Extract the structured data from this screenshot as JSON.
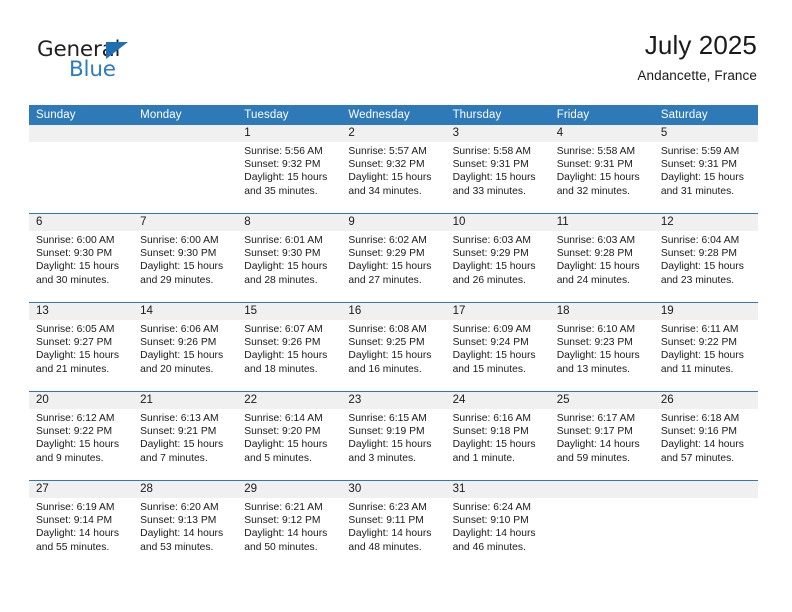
{
  "brand": {
    "word_one": "General",
    "word_two": "Blue",
    "triangle_icon": "triangle-icon",
    "accent_color": "#2b7cc2"
  },
  "header": {
    "title": "July 2025",
    "subtitle": "Andancette, France"
  },
  "theme": {
    "header_blue": "#2e7ab8",
    "band_gray": "#f0f0f0",
    "text": "#1a1a1a"
  },
  "calendar": {
    "weekdays": [
      "Sunday",
      "Monday",
      "Tuesday",
      "Wednesday",
      "Thursday",
      "Friday",
      "Saturday"
    ],
    "weeks": [
      [
        {
          "day": "",
          "empty": true
        },
        {
          "day": "",
          "empty": true
        },
        {
          "day": "1",
          "sunrise": "Sunrise: 5:56 AM",
          "sunset": "Sunset: 9:32 PM",
          "daylight": "Daylight: 15 hours and 35 minutes."
        },
        {
          "day": "2",
          "sunrise": "Sunrise: 5:57 AM",
          "sunset": "Sunset: 9:32 PM",
          "daylight": "Daylight: 15 hours and 34 minutes."
        },
        {
          "day": "3",
          "sunrise": "Sunrise: 5:58 AM",
          "sunset": "Sunset: 9:31 PM",
          "daylight": "Daylight: 15 hours and 33 minutes."
        },
        {
          "day": "4",
          "sunrise": "Sunrise: 5:58 AM",
          "sunset": "Sunset: 9:31 PM",
          "daylight": "Daylight: 15 hours and 32 minutes."
        },
        {
          "day": "5",
          "sunrise": "Sunrise: 5:59 AM",
          "sunset": "Sunset: 9:31 PM",
          "daylight": "Daylight: 15 hours and 31 minutes."
        }
      ],
      [
        {
          "day": "6",
          "sunrise": "Sunrise: 6:00 AM",
          "sunset": "Sunset: 9:30 PM",
          "daylight": "Daylight: 15 hours and 30 minutes."
        },
        {
          "day": "7",
          "sunrise": "Sunrise: 6:00 AM",
          "sunset": "Sunset: 9:30 PM",
          "daylight": "Daylight: 15 hours and 29 minutes."
        },
        {
          "day": "8",
          "sunrise": "Sunrise: 6:01 AM",
          "sunset": "Sunset: 9:30 PM",
          "daylight": "Daylight: 15 hours and 28 minutes."
        },
        {
          "day": "9",
          "sunrise": "Sunrise: 6:02 AM",
          "sunset": "Sunset: 9:29 PM",
          "daylight": "Daylight: 15 hours and 27 minutes."
        },
        {
          "day": "10",
          "sunrise": "Sunrise: 6:03 AM",
          "sunset": "Sunset: 9:29 PM",
          "daylight": "Daylight: 15 hours and 26 minutes."
        },
        {
          "day": "11",
          "sunrise": "Sunrise: 6:03 AM",
          "sunset": "Sunset: 9:28 PM",
          "daylight": "Daylight: 15 hours and 24 minutes."
        },
        {
          "day": "12",
          "sunrise": "Sunrise: 6:04 AM",
          "sunset": "Sunset: 9:28 PM",
          "daylight": "Daylight: 15 hours and 23 minutes."
        }
      ],
      [
        {
          "day": "13",
          "sunrise": "Sunrise: 6:05 AM",
          "sunset": "Sunset: 9:27 PM",
          "daylight": "Daylight: 15 hours and 21 minutes."
        },
        {
          "day": "14",
          "sunrise": "Sunrise: 6:06 AM",
          "sunset": "Sunset: 9:26 PM",
          "daylight": "Daylight: 15 hours and 20 minutes."
        },
        {
          "day": "15",
          "sunrise": "Sunrise: 6:07 AM",
          "sunset": "Sunset: 9:26 PM",
          "daylight": "Daylight: 15 hours and 18 minutes."
        },
        {
          "day": "16",
          "sunrise": "Sunrise: 6:08 AM",
          "sunset": "Sunset: 9:25 PM",
          "daylight": "Daylight: 15 hours and 16 minutes."
        },
        {
          "day": "17",
          "sunrise": "Sunrise: 6:09 AM",
          "sunset": "Sunset: 9:24 PM",
          "daylight": "Daylight: 15 hours and 15 minutes."
        },
        {
          "day": "18",
          "sunrise": "Sunrise: 6:10 AM",
          "sunset": "Sunset: 9:23 PM",
          "daylight": "Daylight: 15 hours and 13 minutes."
        },
        {
          "day": "19",
          "sunrise": "Sunrise: 6:11 AM",
          "sunset": "Sunset: 9:22 PM",
          "daylight": "Daylight: 15 hours and 11 minutes."
        }
      ],
      [
        {
          "day": "20",
          "sunrise": "Sunrise: 6:12 AM",
          "sunset": "Sunset: 9:22 PM",
          "daylight": "Daylight: 15 hours and 9 minutes."
        },
        {
          "day": "21",
          "sunrise": "Sunrise: 6:13 AM",
          "sunset": "Sunset: 9:21 PM",
          "daylight": "Daylight: 15 hours and 7 minutes."
        },
        {
          "day": "22",
          "sunrise": "Sunrise: 6:14 AM",
          "sunset": "Sunset: 9:20 PM",
          "daylight": "Daylight: 15 hours and 5 minutes."
        },
        {
          "day": "23",
          "sunrise": "Sunrise: 6:15 AM",
          "sunset": "Sunset: 9:19 PM",
          "daylight": "Daylight: 15 hours and 3 minutes."
        },
        {
          "day": "24",
          "sunrise": "Sunrise: 6:16 AM",
          "sunset": "Sunset: 9:18 PM",
          "daylight": "Daylight: 15 hours and 1 minute."
        },
        {
          "day": "25",
          "sunrise": "Sunrise: 6:17 AM",
          "sunset": "Sunset: 9:17 PM",
          "daylight": "Daylight: 14 hours and 59 minutes."
        },
        {
          "day": "26",
          "sunrise": "Sunrise: 6:18 AM",
          "sunset": "Sunset: 9:16 PM",
          "daylight": "Daylight: 14 hours and 57 minutes."
        }
      ],
      [
        {
          "day": "27",
          "sunrise": "Sunrise: 6:19 AM",
          "sunset": "Sunset: 9:14 PM",
          "daylight": "Daylight: 14 hours and 55 minutes."
        },
        {
          "day": "28",
          "sunrise": "Sunrise: 6:20 AM",
          "sunset": "Sunset: 9:13 PM",
          "daylight": "Daylight: 14 hours and 53 minutes."
        },
        {
          "day": "29",
          "sunrise": "Sunrise: 6:21 AM",
          "sunset": "Sunset: 9:12 PM",
          "daylight": "Daylight: 14 hours and 50 minutes."
        },
        {
          "day": "30",
          "sunrise": "Sunrise: 6:23 AM",
          "sunset": "Sunset: 9:11 PM",
          "daylight": "Daylight: 14 hours and 48 minutes."
        },
        {
          "day": "31",
          "sunrise": "Sunrise: 6:24 AM",
          "sunset": "Sunset: 9:10 PM",
          "daylight": "Daylight: 14 hours and 46 minutes."
        },
        {
          "day": "",
          "empty": true
        },
        {
          "day": "",
          "empty": true
        }
      ]
    ]
  }
}
